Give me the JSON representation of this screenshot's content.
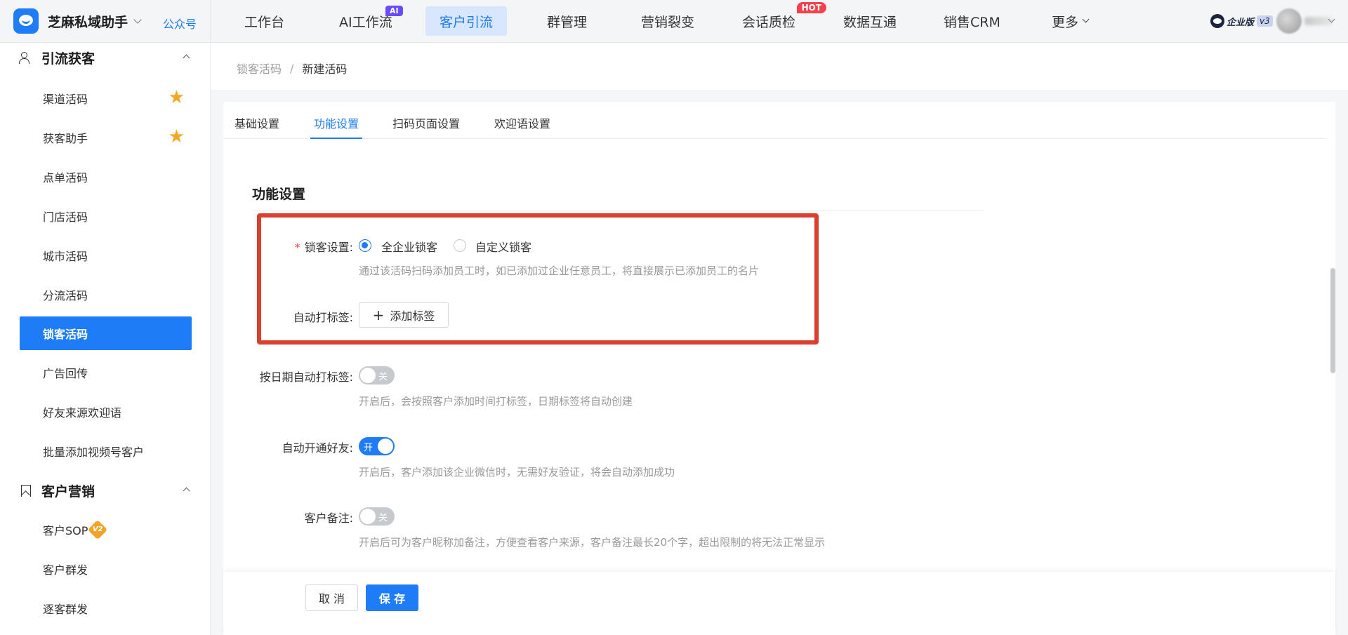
{
  "app": {
    "name": "芝麻私域助手",
    "link": "公众号"
  },
  "nav": {
    "items": [
      "工作台",
      "AI工作流",
      "客户引流",
      "群管理",
      "营销裂变",
      "会话质检",
      "数据互通",
      "销售CRM",
      "更多"
    ],
    "badge_ai": "AI",
    "badge_hot": "HOT"
  },
  "account": {
    "edition": "企业版",
    "version": "v3"
  },
  "sidebar": {
    "group1": "引流获客",
    "group1_items": [
      "渠道活码",
      "获客助手",
      "点单活码",
      "门店活码",
      "城市活码",
      "分流活码",
      "锁客活码",
      "广告回传",
      "好友来源欢迎语",
      "批量添加视频号客户"
    ],
    "group2": "客户营销",
    "group2_items": [
      "客户SOP",
      "客户群发",
      "逐客群发"
    ],
    "v2_badge": "V2"
  },
  "breadcrumb": {
    "parent": "锁客活码",
    "separator": "/",
    "current": "新建活码"
  },
  "tabs": [
    "基础设置",
    "功能设置",
    "扫码页面设置",
    "欢迎语设置"
  ],
  "form": {
    "section_title": "功能设置",
    "lock": {
      "required": "*",
      "label": "锁客设置:",
      "opt_all": "全企业锁客",
      "opt_custom": "自定义锁客",
      "hint": "通过该活码扫码添加员工时，如已添加过企业任意员工，将直接展示已添加员工的名片"
    },
    "auto_tag": {
      "label": "自动打标签:",
      "button": "添加标签"
    },
    "date_tag": {
      "label": "按日期自动打标签:",
      "state": "关",
      "hint": "开启后，会按照客户添加时间打标签，日期标签将自动创建"
    },
    "auto_friend": {
      "label": "自动开通好友:",
      "state": "开",
      "hint": "开启后，客户添加该企业微信时，无需好友验证，将会自动添加成功"
    },
    "remark": {
      "label": "客户备注:",
      "state": "关",
      "hint": "开启后可为客户昵称加备注，方便查看客户来源，客户备注最长20个字，超出限制的将无法正常显示"
    }
  },
  "footer": {
    "cancel": "取 消",
    "save": "保 存"
  },
  "colors": {
    "accent": "#1e7cf6",
    "highlight": "#d9412f",
    "hot": "#f5404e",
    "ai": "#6b4bff",
    "star": "#f5a623"
  }
}
